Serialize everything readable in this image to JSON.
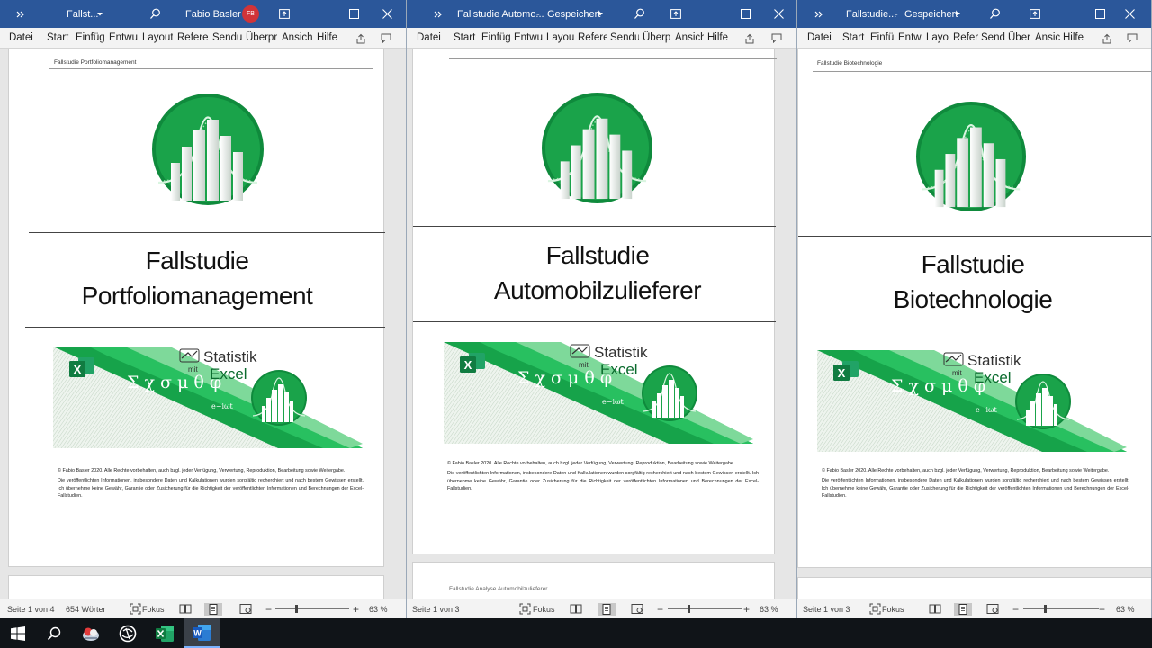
{
  "colors": {
    "titlebar": "#2b579a",
    "accent_green": "#1aa34a",
    "dark_green": "#0b6b2e",
    "taskbar": "#101418"
  },
  "windows": [
    {
      "title": "Fallst...",
      "user_name": "Fabio Basler",
      "user_initials": "FB",
      "ribbon_tabs": [
        "Datei",
        "Start",
        "Einfüg",
        "Entwu",
        "Layout",
        "Refere",
        "Sendu",
        "Überpr",
        "Ansich",
        "Hilfe"
      ],
      "header_text": "Fallstudie Portfoliomanagement",
      "doc_title_line1": "Fallstudie",
      "doc_title_line2": "Portfoliomanagement",
      "status_page": "Seite 1 von 4",
      "status_words": "654 Wörter",
      "focus_label": "Fokus",
      "zoom": "63 %"
    },
    {
      "title": "Fallstudie Automo...",
      "saved_state": "Gespeichert",
      "ribbon_tabs": [
        "Datei",
        "Start",
        "Einfüg",
        "Entwu",
        "Layou",
        "Refere",
        "Sendu",
        "Überp",
        "Ansich",
        "Hilfe"
      ],
      "doc_title_line1": "Fallstudie",
      "doc_title_line2": "Automobilzulieferer",
      "next_page_header": "Fallstudie Analyse Automobilzulieferer",
      "status_page": "Seite 1 von 3",
      "focus_label": "Fokus",
      "zoom": "63 %"
    },
    {
      "title": "Fallstudie...",
      "saved_state": "Gespeichert",
      "ribbon_tabs": [
        "Datei",
        "Start",
        "Einfü",
        "Entw",
        "Layo",
        "Refer",
        "Send",
        "Über",
        "Ansic",
        "Hilfe"
      ],
      "header_text": "Fallstudie Biotechnologie",
      "doc_title_line1": "Fallstudie",
      "doc_title_line2": "Biotechnologie",
      "status_page": "Seite 1 von 3",
      "focus_label": "Fokus",
      "zoom": "63 %"
    }
  ],
  "banner": {
    "word1": "Statistik",
    "word_mit": "mit",
    "word2": "Excel",
    "greek": "Σ χ σ μ θ φ",
    "exponent": "e−iωt",
    "excel_letter": "X"
  },
  "copyright": {
    "line1": "© Fabio Basler 2020. Alle Rechte vorbehalten, auch bzgl. jeder Verfügung, Verwertung, Reproduktion, Bearbeitung sowie Weitergabe.",
    "line2": "Die veröffentlichten Informationen, insbesondere Daten und Kalkulationen wurden sorgfältig recherchiert und nach bestem Gewissen erstellt. Ich übernehme keine Gewähr, Garantie oder Zusicherung für die Richtigkeit der veröffentlichten Informationen und Berechnungen der Excel-Fallstudien."
  },
  "taskbar": {
    "items": [
      "windows-start",
      "search",
      "photos",
      "browser",
      "excel",
      "word"
    ],
    "word_letter": "W"
  }
}
